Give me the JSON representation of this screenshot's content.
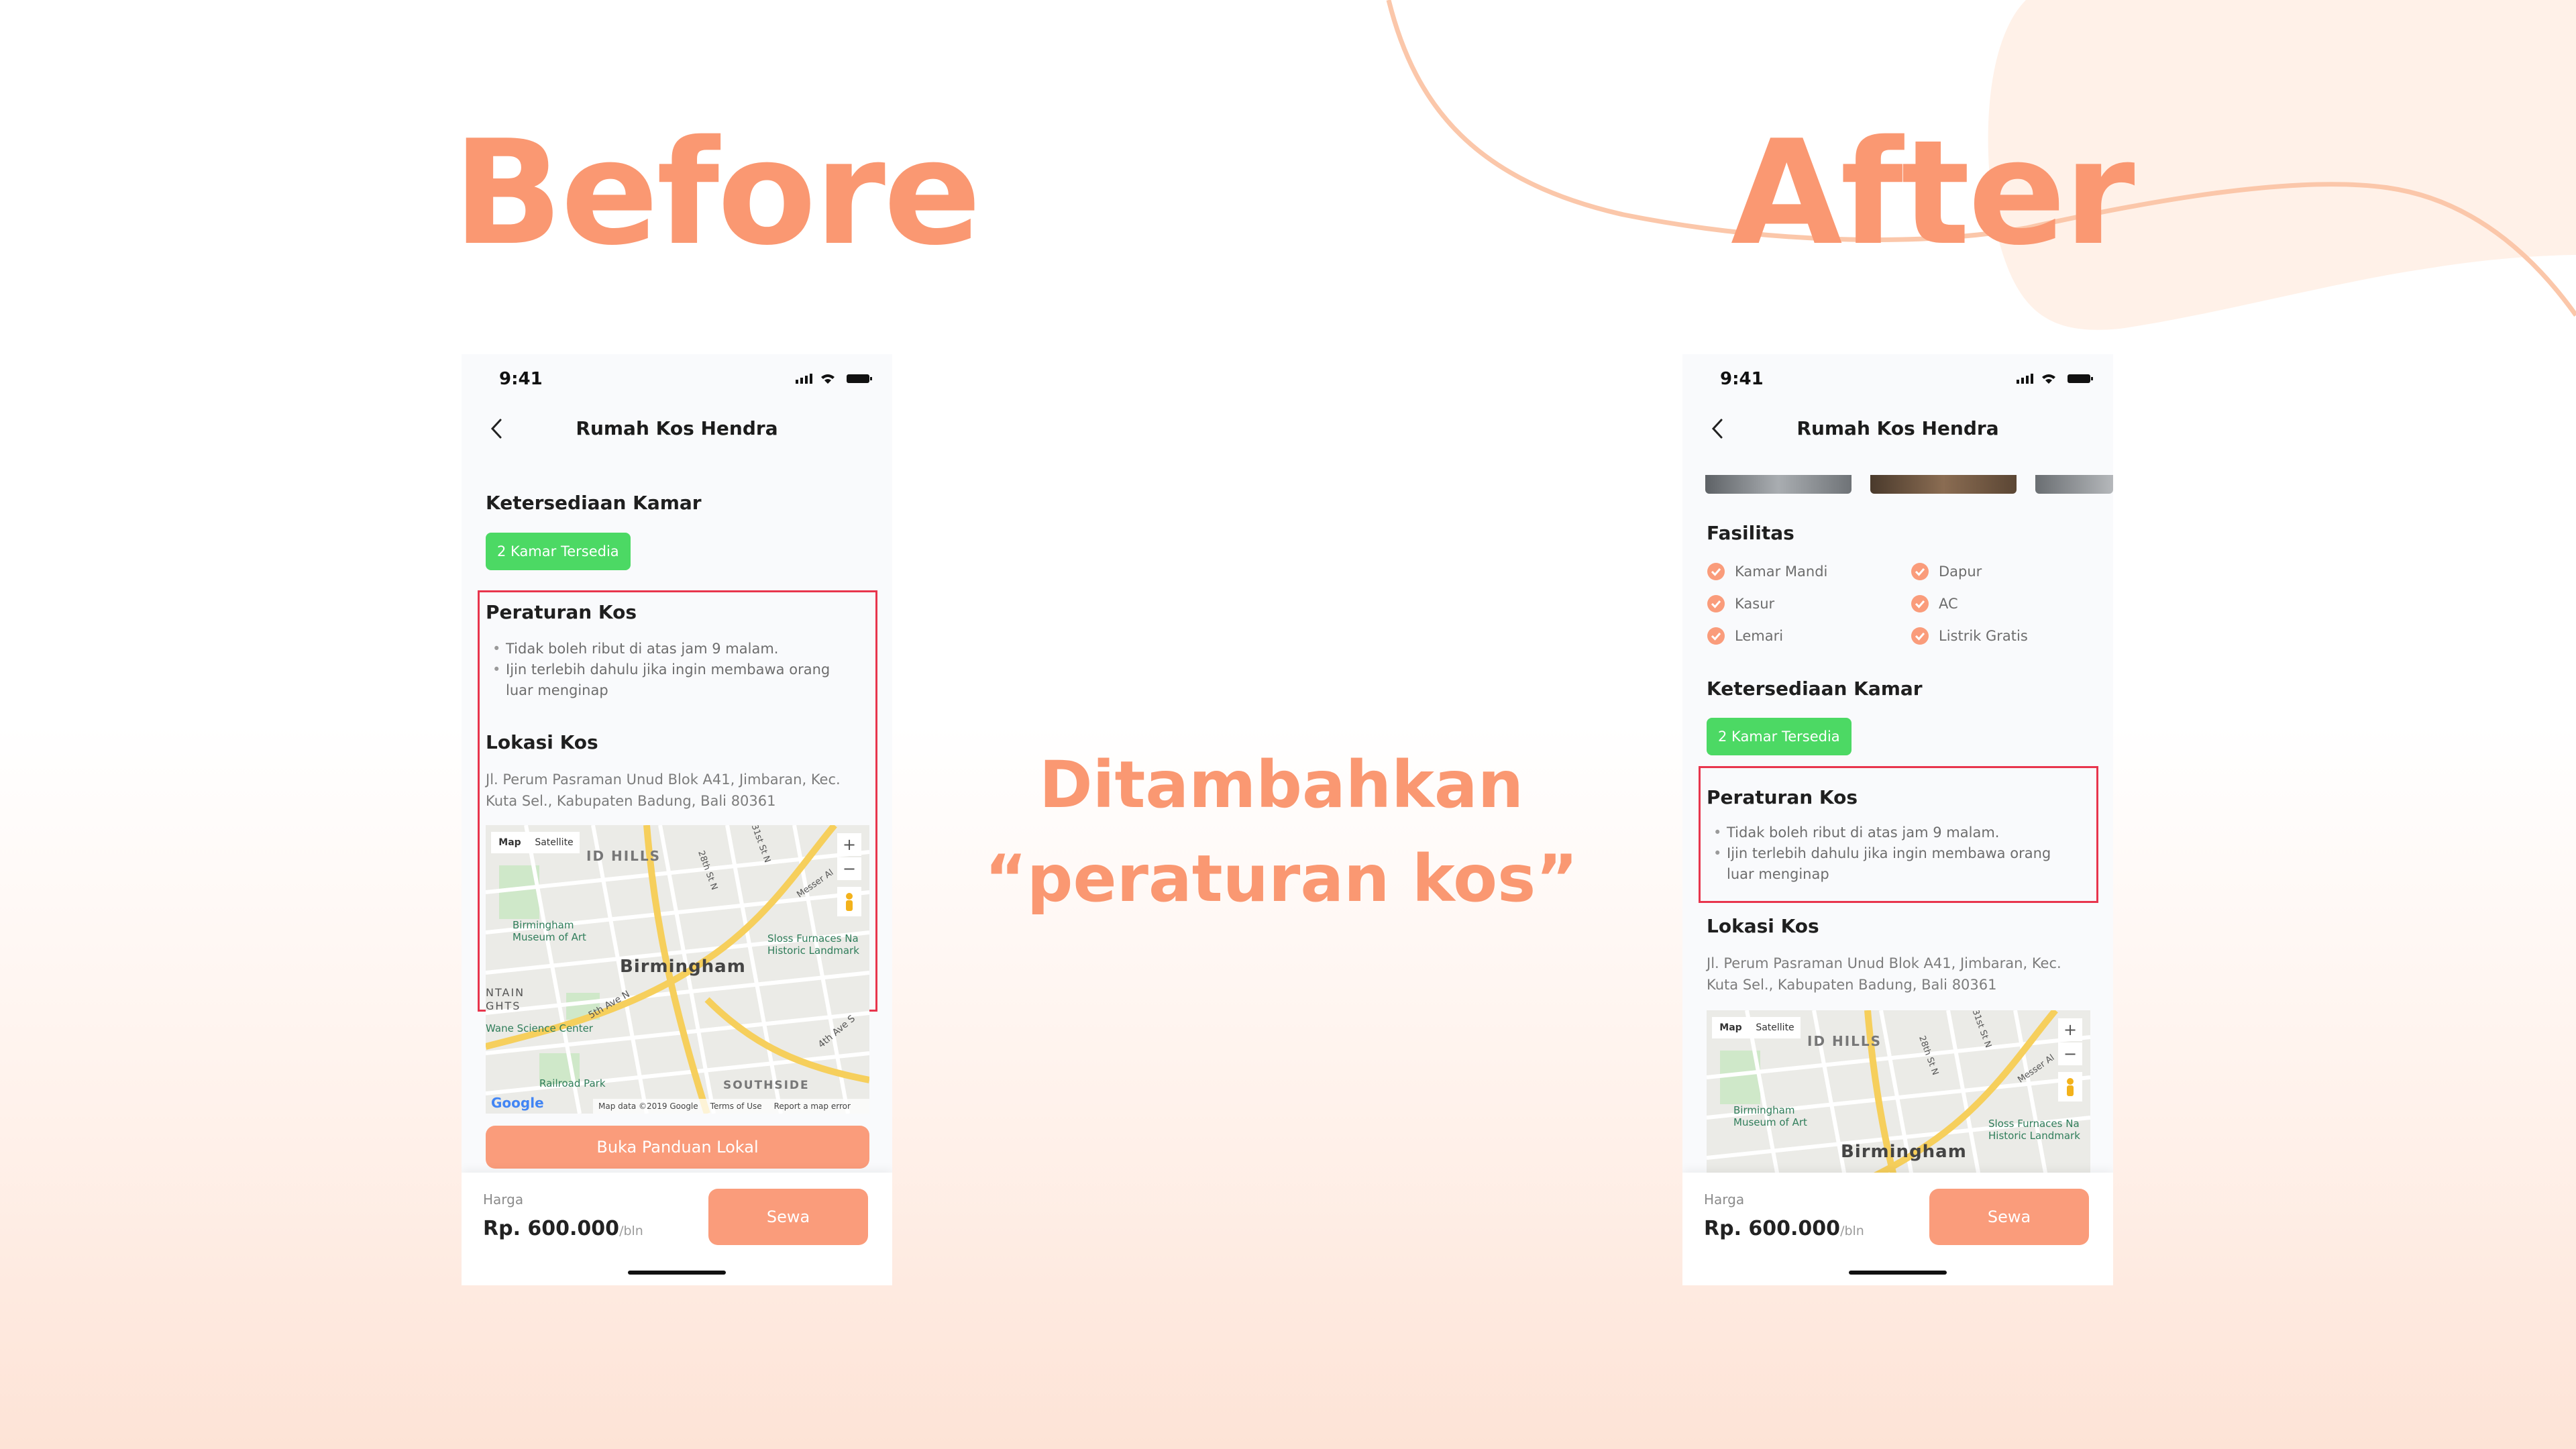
{
  "colors": {
    "accent": "#fa9872",
    "button": "#fa9c7b",
    "badge_green": "#4cd964",
    "highlight_red": "#e8354d"
  },
  "headings": {
    "before": "Before",
    "after": "After",
    "caption_line1": "Ditambahkan",
    "caption_line2": "“peraturan kos”"
  },
  "screen": {
    "status_time": "9:41",
    "title": "Rumah Kos Hendra",
    "availability_title": "Ketersediaan Kamar",
    "availability_badge": "2 Kamar Tersedia",
    "rules_title": "Peraturan Kos",
    "rules": [
      "Tidak boleh ribut di atas jam 9 malam.",
      "Ijin terlebih dahulu jika ingin membawa orang luar menginap"
    ],
    "location_title": "Lokasi Kos",
    "address": "Jl. Perum Pasraman Unud Blok A41, Jimbaran, Kec. Kuta Sel., Kabupaten Badung, Bali 80361",
    "facilities_title": "Fasilitas",
    "facilities_left": [
      "Kamar Mandi",
      "Kasur",
      "Lemari"
    ],
    "facilities_right": [
      "Dapur",
      "AC",
      "Listrik Gratis"
    ],
    "local_guide_button": "Buka Panduan Lokal",
    "price_label": "Harga",
    "price_value": "Rp. 600.000",
    "price_unit": "/bln",
    "rent_button": "Sewa"
  },
  "map": {
    "tab_map": "Map",
    "tab_satellite": "Satellite",
    "zoom_in": "+",
    "zoom_out": "−",
    "city_label": "Birmingham",
    "hills_label": "ID HILLS",
    "museum_label": "Birmingham Museum of Art",
    "sloss_label": "Sloss Furnaces Na Historic Landmark",
    "mountain_label": "NTAIN GHTS",
    "science_label": "Wane Science Center",
    "railroad_label": "Railroad Park",
    "southside_label": "SOUTHSIDE",
    "street_5th": "5th Ave N",
    "street_4th": "4th Ave S",
    "street_28": "28th St N",
    "street_31": "31st St N",
    "street_messer": "Messer Al",
    "footer_data": "Map data ©2019 Google",
    "footer_terms": "Terms of Use",
    "footer_report": "Report a map error",
    "google_logo": "Google"
  }
}
